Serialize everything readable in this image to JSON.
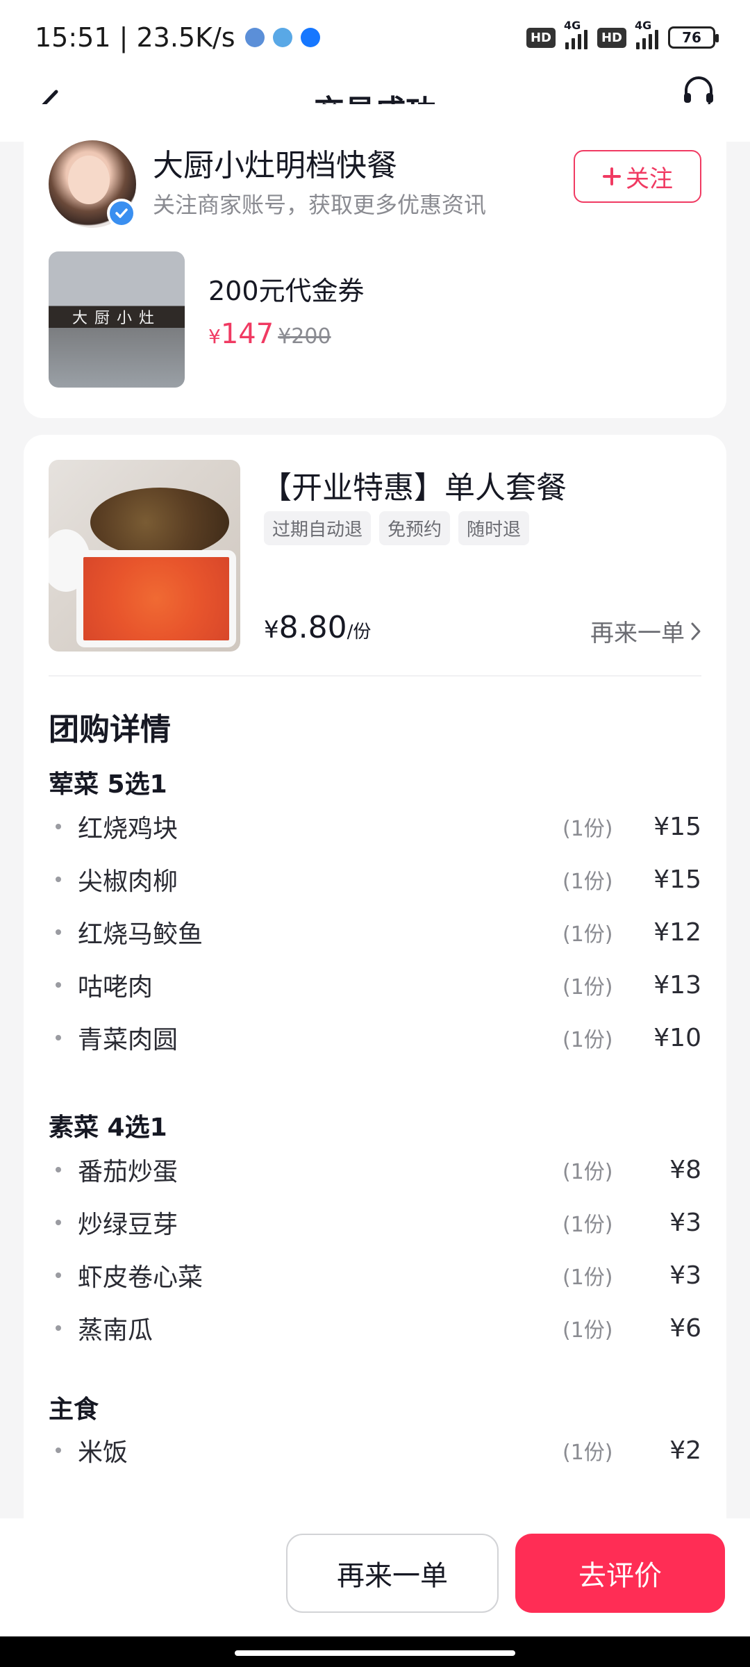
{
  "status_bar": {
    "time_speed": "15:51 | 23.5K/s",
    "hd1": "HD",
    "net1": "4G",
    "hd2": "HD",
    "net2": "4G",
    "battery": "76"
  },
  "header": {
    "title": "交易成功",
    "service_label": "客服"
  },
  "store": {
    "name": "大厨小灶明档快餐",
    "subtitle": "关注商家账号，获取更多优惠资讯",
    "follow_label": "关注",
    "sign_text": "大厨小灶"
  },
  "voucher": {
    "title": "200元代金券",
    "price_symbol": "¥",
    "price": "147",
    "original_price": "¥200"
  },
  "deal": {
    "title": "【开业特惠】单人套餐",
    "tags": [
      "过期自动退",
      "免预约",
      "随时退"
    ],
    "price_symbol": "¥",
    "price": "8.80",
    "unit": "/份",
    "reorder_link": "再来一单"
  },
  "details": {
    "section_title": "团购详情",
    "groups": [
      {
        "title": "荤菜 5选1",
        "items": [
          {
            "name": "红烧鸡块",
            "qty": "(1份)",
            "price": "¥15"
          },
          {
            "name": "尖椒肉柳",
            "qty": "(1份)",
            "price": "¥15"
          },
          {
            "name": "红烧马鲛鱼",
            "qty": "(1份)",
            "price": "¥12"
          },
          {
            "name": "咕咾肉",
            "qty": "(1份)",
            "price": "¥13"
          },
          {
            "name": "青菜肉圆",
            "qty": "(1份)",
            "price": "¥10"
          }
        ]
      },
      {
        "title": "素菜 4选1",
        "items": [
          {
            "name": "番茄炒蛋",
            "qty": "(1份)",
            "price": "¥8"
          },
          {
            "name": "炒绿豆芽",
            "qty": "(1份)",
            "price": "¥3"
          },
          {
            "name": "虾皮卷心菜",
            "qty": "(1份)",
            "price": "¥3"
          },
          {
            "name": "蒸南瓜",
            "qty": "(1份)",
            "price": "¥6"
          }
        ]
      },
      {
        "title": "主食",
        "items": [
          {
            "name": "米饭",
            "qty": "(1份)",
            "price": "¥2"
          }
        ]
      }
    ]
  },
  "bottom_bar": {
    "reorder_label": "再来一单",
    "review_label": "去评价"
  },
  "colors": {
    "accent": "#ff2d55",
    "price_red": "#f03a62"
  }
}
